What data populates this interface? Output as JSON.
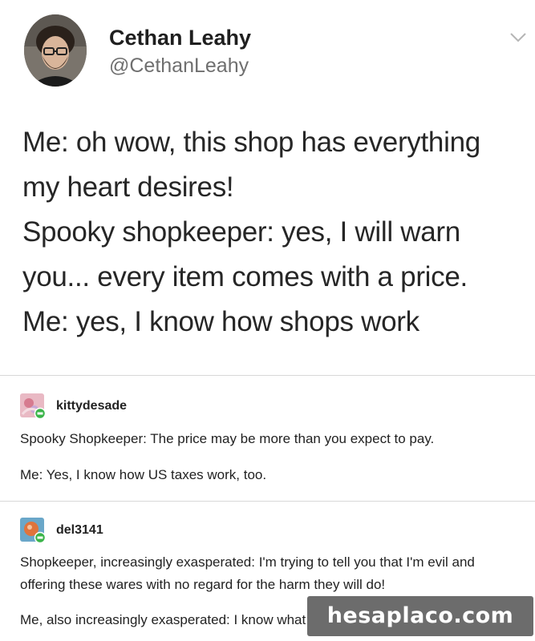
{
  "tweet": {
    "name": "Cethan Leahy",
    "handle": "@CethanLeahy",
    "lines": [
      "Me: oh wow, this shop has everything",
      "my heart desires!",
      "Spooky shopkeeper: yes, I will warn",
      "you... every item comes with a price.",
      "Me: yes, I know how shops work"
    ]
  },
  "replies": [
    {
      "username": "kittydesade",
      "lines": [
        "Spooky Shopkeeper: The price may be more than you expect to pay.",
        "Me: Yes, I know how US taxes work, too."
      ]
    },
    {
      "username": "del3141",
      "lines": [
        "Shopkeeper, increasingly exasperated: I'm trying to tell you that I'm evil and",
        "offering these wares with no regard for the harm they will do!",
        "Me, also increasingly exasperated: I know what"
      ]
    }
  ],
  "watermark": {
    "text": "hesaplaco.com"
  },
  "icons": {
    "menu": "chevron-down-icon",
    "follow_badge": "follow-badge-icon"
  },
  "colors": {
    "name": "#1f1f1f",
    "handle": "#6f6f6f",
    "divider": "#d8d8d8",
    "badge_green": "#3bb44a",
    "watermark_bg": "#6c6c6c"
  }
}
